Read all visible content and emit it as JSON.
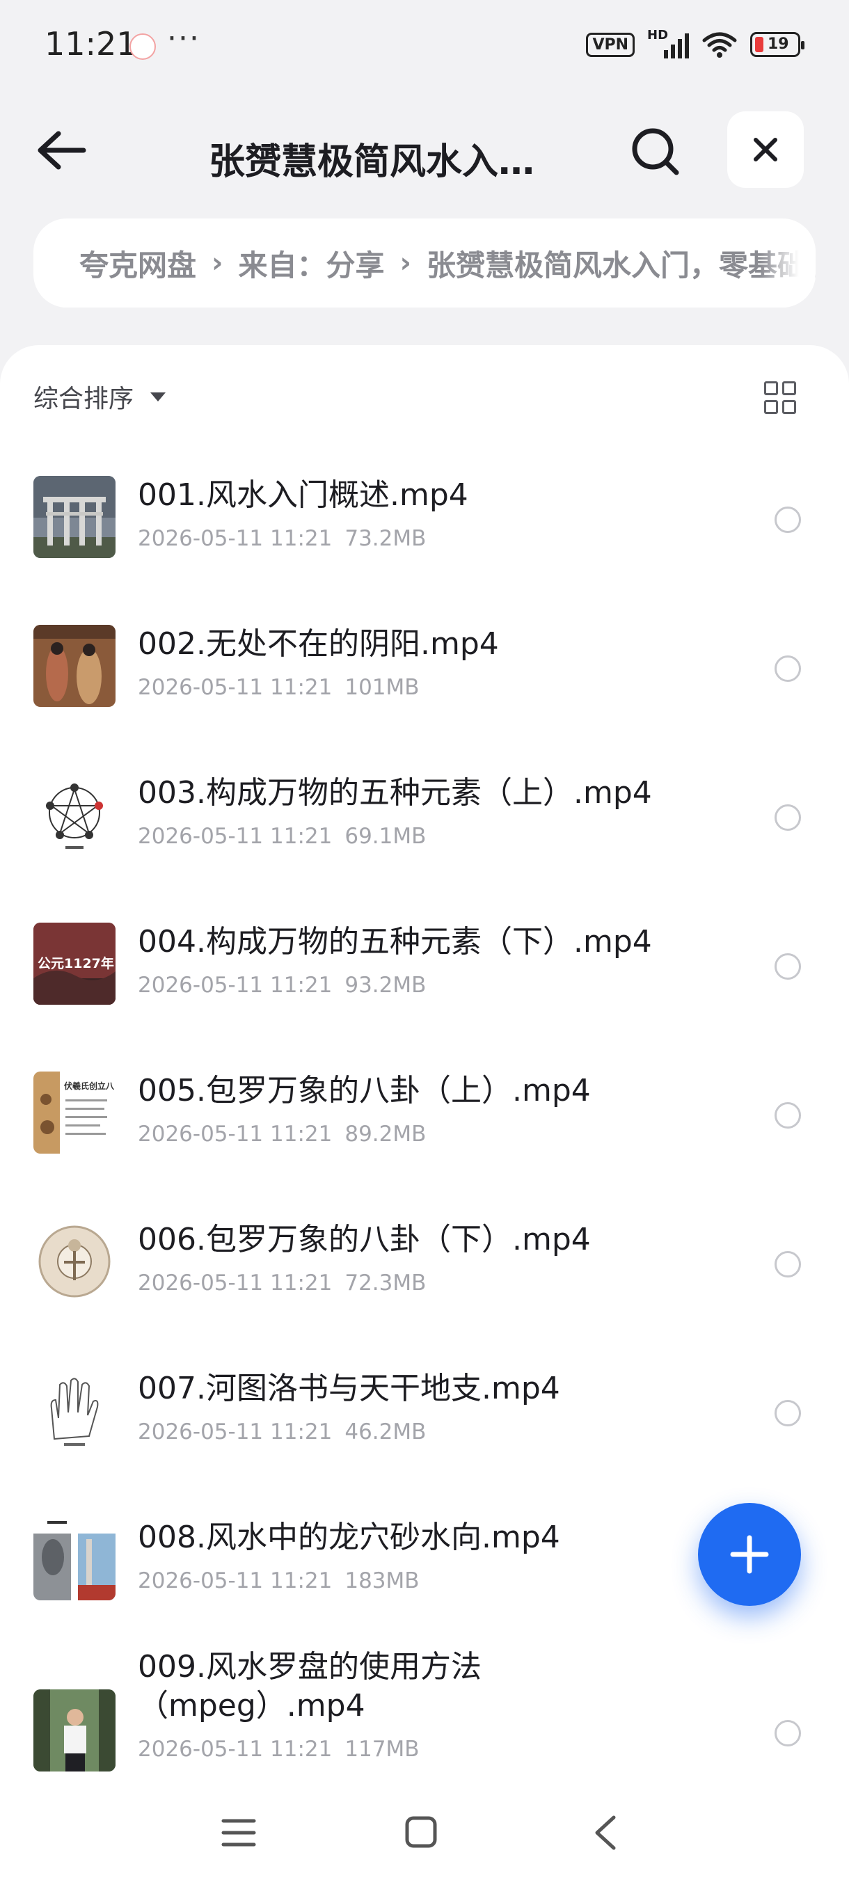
{
  "status_bar": {
    "time": "11:21",
    "more_dots": "···",
    "vpn_label": "VPN",
    "hd_label": "HD",
    "battery": "19"
  },
  "header": {
    "title": "张赟慧极简风水入门，零基础也能学会"
  },
  "breadcrumb": {
    "items": [
      "夸克网盘",
      "来自：分享",
      "张赟慧极简风水入门，零基础也能学会"
    ],
    "separator": "›"
  },
  "toolbar": {
    "sort_label": "综合排序"
  },
  "files": [
    {
      "name": "001.风水入门概述.mp4",
      "date": "2026-05-11 11:21",
      "size": "73.2MB"
    },
    {
      "name": "002.无处不在的阴阳.mp4",
      "date": "2026-05-11 11:21",
      "size": "101MB"
    },
    {
      "name": "003.构成万物的五种元素（上）.mp4",
      "date": "2026-05-11 11:21",
      "size": "69.1MB"
    },
    {
      "name": "004.构成万物的五种元素（下）.mp4",
      "date": "2026-05-11 11:21",
      "size": "93.2MB"
    },
    {
      "name": "005.包罗万象的八卦（上）.mp4",
      "date": "2026-05-11 11:21",
      "size": "89.2MB"
    },
    {
      "name": "006.包罗万象的八卦（下）.mp4",
      "date": "2026-05-11 11:21",
      "size": "72.3MB"
    },
    {
      "name": "007.河图洛书与天干地支.mp4",
      "date": "2026-05-11 11:21",
      "size": "46.2MB"
    },
    {
      "name": "008.风水中的龙穴砂水向.mp4",
      "date": "2026-05-11 11:21",
      "size": "183MB"
    },
    {
      "name": "009.风水罗盘的使用方法（mpeg）.mp4",
      "date": "2026-05-11 11:21",
      "size": "117MB"
    }
  ],
  "thumb_text": {
    "t4": "公元1127年",
    "t5": "伏羲氏创立八"
  },
  "colors": {
    "accent": "#1f6bf2",
    "background": "#f2f2f4",
    "meta_text": "#a3a4aa"
  },
  "icons": [
    "back-arrow-icon",
    "search-icon",
    "close-icon",
    "grid-view-icon",
    "plus-icon",
    "menu-icon",
    "home-icon",
    "back-icon"
  ]
}
